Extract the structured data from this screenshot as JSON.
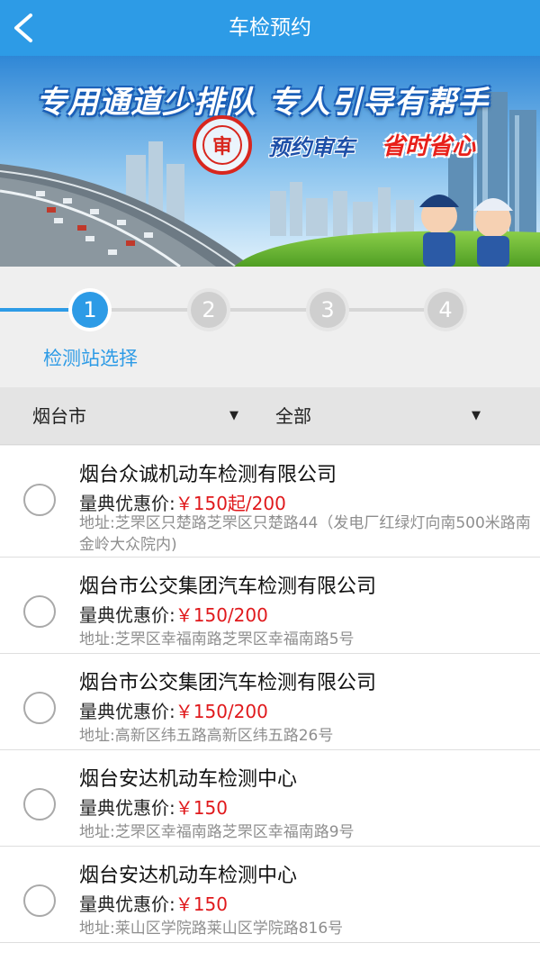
{
  "header": {
    "title": "车检预约",
    "back_icon": "chevron-left-icon",
    "background": "#2d9be6"
  },
  "banner": {
    "slogan": "专用通道少排队 专人引导有帮手",
    "stamp_char": "审",
    "tag_blue": "预约审车",
    "tag_red": "省时省心"
  },
  "steps": {
    "items": [
      "1",
      "2",
      "3",
      "4"
    ],
    "active_index": 0,
    "current_label": "检测站选择",
    "accent": "#2d9be6"
  },
  "filters": {
    "city": "烟台市",
    "district": "全部",
    "dropdown_icon": "caret-down-icon"
  },
  "price_label": "量典优惠价:",
  "stations": [
    {
      "name": "烟台众诚机动车检测有限公司",
      "price": "￥150起/200",
      "address": "地址:芝罘区只楚路芝罘区只楚路44（发电厂红绿灯向南500米路南金岭大众院内)"
    },
    {
      "name": "烟台市公交集团汽车检测有限公司",
      "price": "￥150/200",
      "address": "地址:芝罘区幸福南路芝罘区幸福南路5号"
    },
    {
      "name": "烟台市公交集团汽车检测有限公司",
      "price": "￥150/200",
      "address": "地址:高新区纬五路高新区纬五路26号"
    },
    {
      "name": "烟台安达机动车检测中心",
      "price": "￥150",
      "address": "地址:芝罘区幸福南路芝罘区幸福南路9号"
    },
    {
      "name": "烟台安达机动车检测中心",
      "price": "￥150",
      "address": "地址:莱山区学院路莱山区学院路816号"
    }
  ],
  "colors": {
    "price": "#e0191c",
    "address": "#8e8e8e"
  }
}
